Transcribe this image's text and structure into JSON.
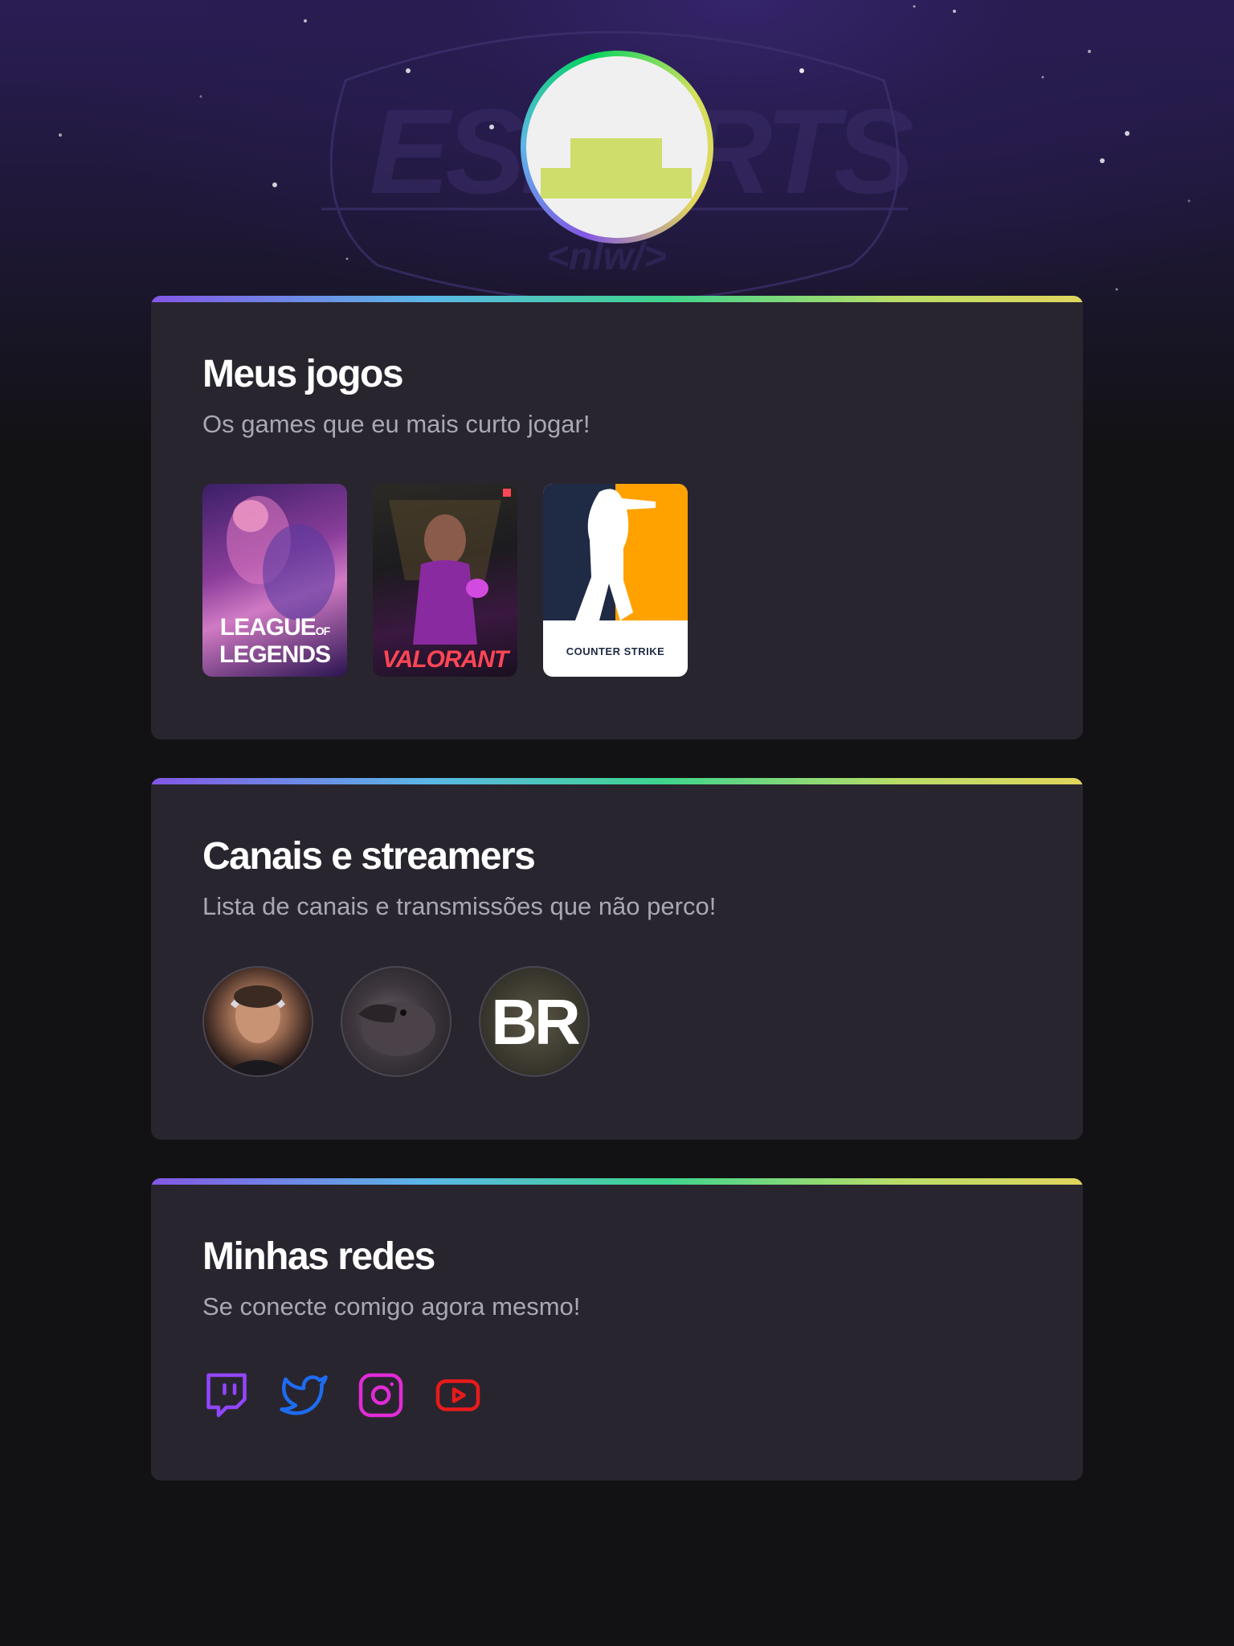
{
  "profile": {
    "avatar_alt": "Avatar"
  },
  "games_section": {
    "title": "Meus jogos",
    "subtitle": "Os games que eu mais curto jogar!",
    "games": [
      {
        "name": "League of Legends",
        "label": "LEAGUE OF LEGENDS"
      },
      {
        "name": "Valorant",
        "label": "VALORANT"
      },
      {
        "name": "Counter Strike",
        "label": "COUNTER STRIKE"
      }
    ]
  },
  "channels_section": {
    "title": "Canais e streamers",
    "subtitle": "Lista de canais e transmissões que não perco!",
    "streamer_3_text": "BR"
  },
  "social_section": {
    "title": "Minhas redes",
    "subtitle": "Se conecte comigo agora mesmo!",
    "networks": [
      "twitch-icon",
      "twitter-icon",
      "instagram-icon",
      "youtube-icon"
    ]
  },
  "colors": {
    "background": "#121214",
    "card": "#29252f",
    "accent_gradient": [
      "#8257e5",
      "#04d361",
      "#e1d55d"
    ],
    "twitch": "#9146ff",
    "twitter": "#1d6cf0",
    "instagram": "#e22bd6",
    "youtube": "#e81b1b"
  }
}
